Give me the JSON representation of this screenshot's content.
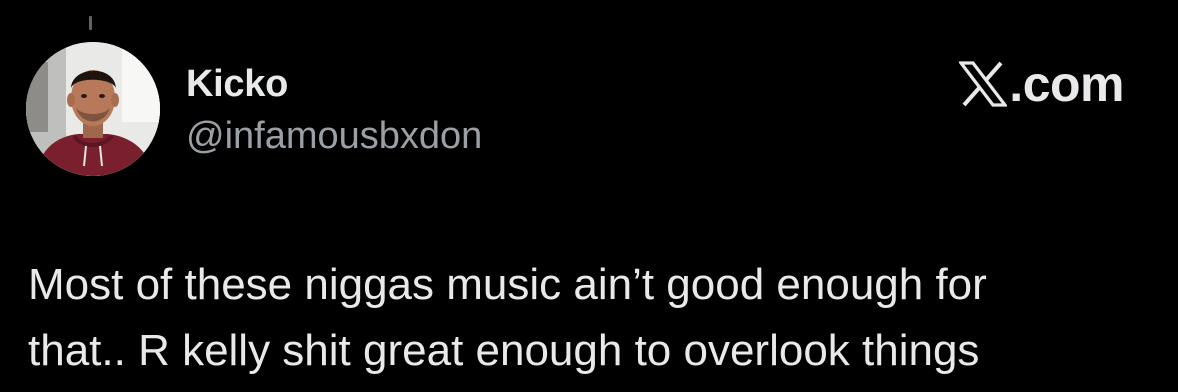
{
  "tweet": {
    "author": {
      "display_name": "Kicko",
      "handle": "@infamousbxdon",
      "avatar": "profile-photo"
    },
    "brand": {
      "icon": "x-logo-icon",
      "text": ".com"
    },
    "text": "Most of these niggas music ain’t good enough for\nthat.. R kelly shit great enough to overlook things"
  },
  "colors": {
    "background": "#000000",
    "primary_text": "#e7e9ea",
    "secondary_text": "#9aa0a6"
  }
}
